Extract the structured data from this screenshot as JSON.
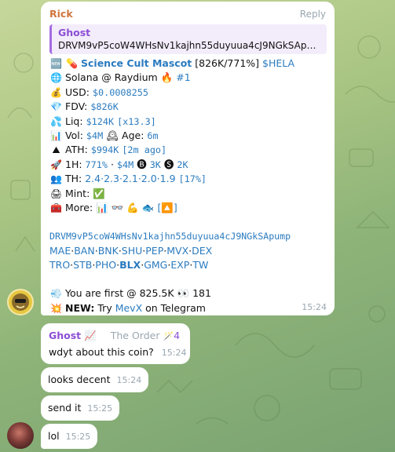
{
  "bot_message": {
    "sender": "Rick",
    "reply_label": "Reply",
    "quote": {
      "name": "Ghost",
      "text": "DRVM9vP5coW4WHsNv1kajhn55duyuua4cJ9NGkSApu..."
    },
    "lines": [
      {
        "icons": [
          "🆕",
          "💊"
        ],
        "title": "Science Cult Mascot",
        "stats": " [826K/771%] ",
        "ticker": "$HELA"
      },
      {
        "icon": "🌐",
        "text": "Solana @ Raydium ",
        "extra": "🔥",
        "rank": "#1"
      },
      {
        "icon": "💰",
        "label": "USD: ",
        "value": "$0.0008255"
      },
      {
        "icon": "💎",
        "label": "FDV: ",
        "value": "$826K"
      },
      {
        "icon": "💦",
        "label": "Liq: ",
        "value": "$124K",
        "value2": "[x13.3]"
      },
      {
        "icon": "📊",
        "label": "Vol: ",
        "value": "$4M",
        "sep_icon": "🕰",
        "label2": "Age: ",
        "value2": "6m"
      },
      {
        "icon": "⛰",
        "label": "ATH: ",
        "value": "$994K",
        "value2": "[2m ago]"
      },
      {
        "icon": "🚀",
        "label": "1H: ",
        "value": "771%",
        "mid": " · ",
        "value2": "$4M",
        "b_icon": "🅑",
        "b_val": "3K",
        "s_icon": "🅢",
        "s_val": "2K"
      },
      {
        "icon": "👥",
        "label": "TH: ",
        "value": "2.4·2.3·2.1·2.0·1.9",
        "value2": "[17%]"
      },
      {
        "icon": "🖨",
        "label": "Mint: ",
        "badge": "✅"
      },
      {
        "icon": "🧰",
        "label": "More: ",
        "tools": [
          "📊",
          "👓",
          "💪",
          "🐟"
        ],
        "tools_end": "[🔼]"
      }
    ],
    "address": "DRVM9vP5coW4WHsNv1kajhn55duyuua4cJ9NGkSApump",
    "links_row1": [
      "MAE",
      "BAN",
      "BNK",
      "SHU",
      "PEP",
      "MVX",
      "DEX"
    ],
    "links_row2": [
      "TRO",
      "STB",
      "PHO",
      "BLX",
      "GMG",
      "EXP",
      "TW"
    ],
    "first_line": {
      "icon": "💨",
      "text": "You are first @ 825.5K ",
      "eyes": "👀",
      "count": " 181"
    },
    "new_line": {
      "icon": "💥",
      "label": "NEW:",
      "pre": " Try ",
      "link": "MevX",
      "post": " on Telegram"
    },
    "time": "15:24"
  },
  "ghost_message": {
    "sender": "Ghost",
    "sender_emoji": "📈",
    "group": "The Order",
    "badge_icon": "🪄",
    "badge_count": "4",
    "text": "wdyt about this coin?",
    "time": "15:24"
  },
  "messages": [
    {
      "text": "looks decent",
      "time": "15:24"
    },
    {
      "text": "send it",
      "time": "15:25"
    },
    {
      "text": "lol",
      "time": "15:25"
    }
  ],
  "colors": {
    "accent_link": "#2a7bbf",
    "sender_rick": "#d0743c",
    "sender_ghost": "#8c4fd6",
    "timestamp": "#9aa7b0"
  }
}
